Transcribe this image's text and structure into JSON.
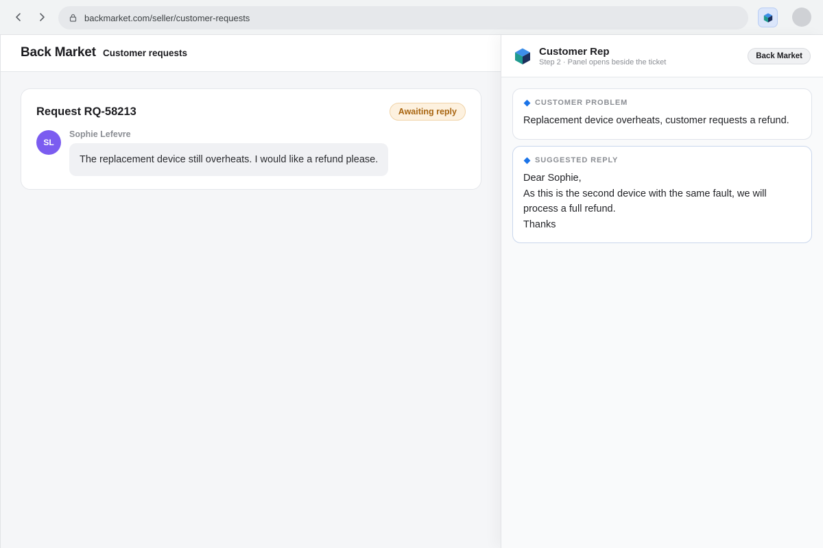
{
  "browser": {
    "url": "backmarket.com/seller/customer-requests"
  },
  "site": {
    "brand": "Back Market",
    "nav_label": "Customer requests"
  },
  "request": {
    "title": "Request RQ-58213",
    "status": "Awaiting reply",
    "sender_initials": "SL",
    "sender_name": "Sophie Lefevre",
    "message": "The replacement device still overheats. I would like a refund please."
  },
  "panel": {
    "title": "Customer Rep",
    "subtitle": "Step 2 · Panel opens beside the ticket",
    "chip": "Back Market",
    "problem_label": "CUSTOMER PROBLEM",
    "problem_text": "Replacement device overheats, customer requests a refund.",
    "reply_label": "SUGGESTED REPLY",
    "reply_lines": [
      "Dear Sophie,",
      "As this is the second device with the same fault, we will process a full refund.",
      "Thanks"
    ]
  },
  "colors": {
    "accent": "#1a73e8",
    "avatar": "#7b5cf0",
    "status_text": "#a86510",
    "status_bg": "#fdf1df"
  },
  "icons": {
    "back": "chevron-left-icon",
    "forward": "chevron-right-icon",
    "lock": "lock-icon",
    "extension": "cube-icon",
    "panel_logo": "cube-logo-icon"
  }
}
